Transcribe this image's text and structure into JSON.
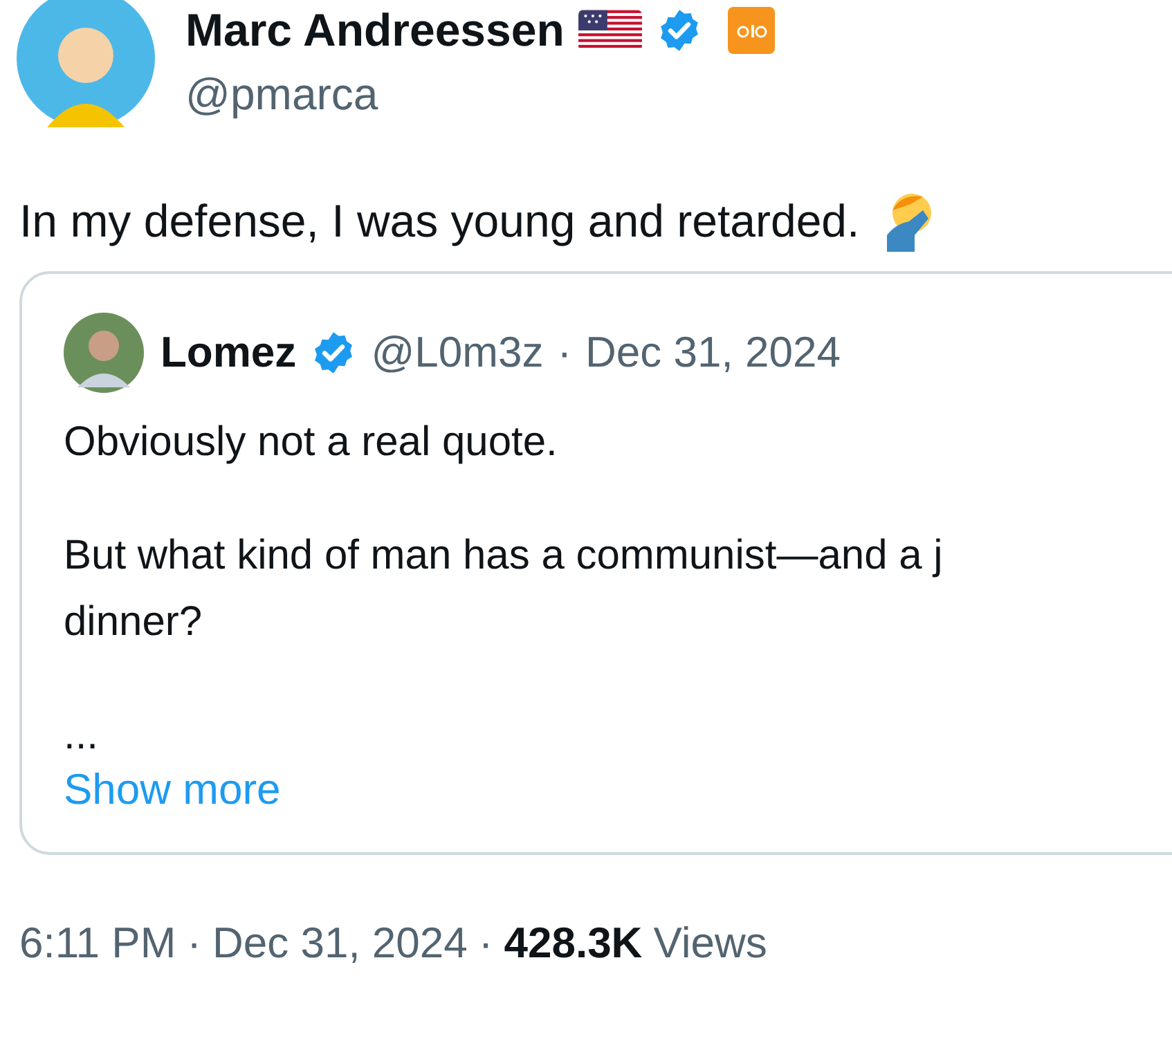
{
  "author": {
    "name": "Marc Andreessen",
    "handle": "@pmarca",
    "verified": true
  },
  "tweet": {
    "text": "In my defense, I was young and retarded."
  },
  "quote": {
    "name": "Lomez",
    "verified": true,
    "handle": "@L0m3z",
    "separator": "·",
    "date": "Dec 31, 2024",
    "paragraphs": [
      "Obviously not a real quote.",
      "But what kind of man has a communist—and a j\ndinner?",
      "..."
    ],
    "show_more": "Show more"
  },
  "footer": {
    "time": "6:11 PM",
    "separator_1": "·",
    "date": "Dec 31, 2024",
    "separator_2": "·",
    "views_count": "428.3K",
    "views_label": "Views"
  }
}
